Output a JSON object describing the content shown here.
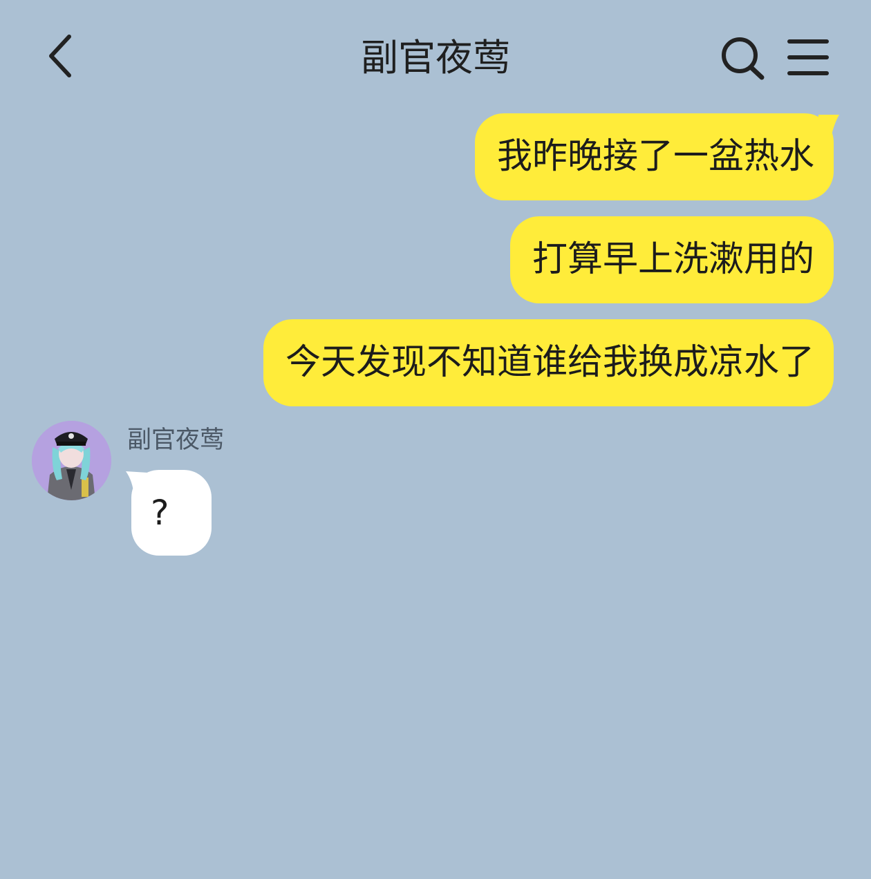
{
  "header": {
    "title": "副官夜莺",
    "back_icon": "chevron-left-icon",
    "search_icon": "search-icon",
    "menu_icon": "hamburger-menu-icon"
  },
  "colors": {
    "background": "#abc0d3",
    "outgoing_bubble": "#ffec3a",
    "incoming_bubble": "#ffffff",
    "avatar_bg": "#b5a1e0"
  },
  "messages": {
    "out": [
      "我昨晚接了一盆热水",
      "打算早上洗漱用的",
      "今天发现不知道谁给我换成凉水了"
    ],
    "in": {
      "sender": "副官夜莺",
      "text": "?"
    }
  }
}
